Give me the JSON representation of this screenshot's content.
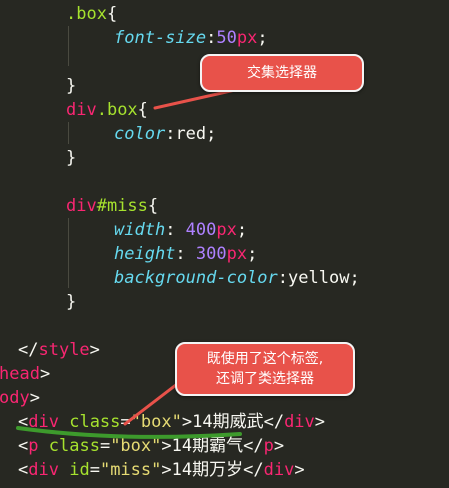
{
  "code": {
    "l1": {
      "sel": ".box",
      "brace": "{"
    },
    "l2": {
      "prop": "font-size",
      "colon": ":",
      "num": "50",
      "unit": "px",
      "semi": ";"
    },
    "l4": {
      "brace": "}"
    },
    "l5": {
      "tag": "div",
      "sel": ".box",
      "brace": "{"
    },
    "l6": {
      "prop": "color",
      "colon": ":",
      "val": "red",
      "semi": ";"
    },
    "l7": {
      "brace": "}"
    },
    "l9": {
      "tag": "div",
      "sel": "#miss",
      "brace": "{"
    },
    "l10": {
      "prop": "width",
      "colon": ": ",
      "num": "400",
      "unit": "px",
      "semi": ";"
    },
    "l11": {
      "prop": "height",
      "colon": ": ",
      "num": "300",
      "unit": "px",
      "semi": ";"
    },
    "l12": {
      "prop": "background-color",
      "colon": ":",
      "val": "yellow",
      "semi": ";"
    },
    "l13": {
      "brace": "}"
    },
    "l15": {
      "open": "</",
      "tag": "style",
      "close": ">"
    },
    "l16": {
      "tag": "head",
      "close": ">"
    },
    "l17": {
      "tag": "ody",
      "close": ">"
    },
    "l18": {
      "lt": "<",
      "tag": "div",
      "attr": "class",
      "eq": "=",
      "str": "\"box\"",
      "gt": ">",
      "text": "14期威武",
      "ctag_open": "</",
      "ctag": "div",
      "ctag_close": ">"
    },
    "l19": {
      "lt": "<",
      "tag": "p",
      "attr": "class",
      "eq": "=",
      "str": "\"box\"",
      "gt": ">",
      "text": "14期霸气",
      "ctag_open": "</",
      "ctag": "p",
      "ctag_close": ">"
    },
    "l20": {
      "lt": "<",
      "tag": "div",
      "attr": "id",
      "eq": "=",
      "str": "\"miss\"",
      "gt": ">",
      "text": "14期万岁",
      "ctag_open": "</",
      "ctag": "div",
      "ctag_close": ">"
    }
  },
  "callouts": {
    "intersection": "交集选择器",
    "usage_line1": "既使用了这个标签,",
    "usage_line2": "还调了类选择器"
  },
  "colors": {
    "background": "#272822",
    "callout": "#e8524a",
    "underline": "#3d9a2c"
  }
}
